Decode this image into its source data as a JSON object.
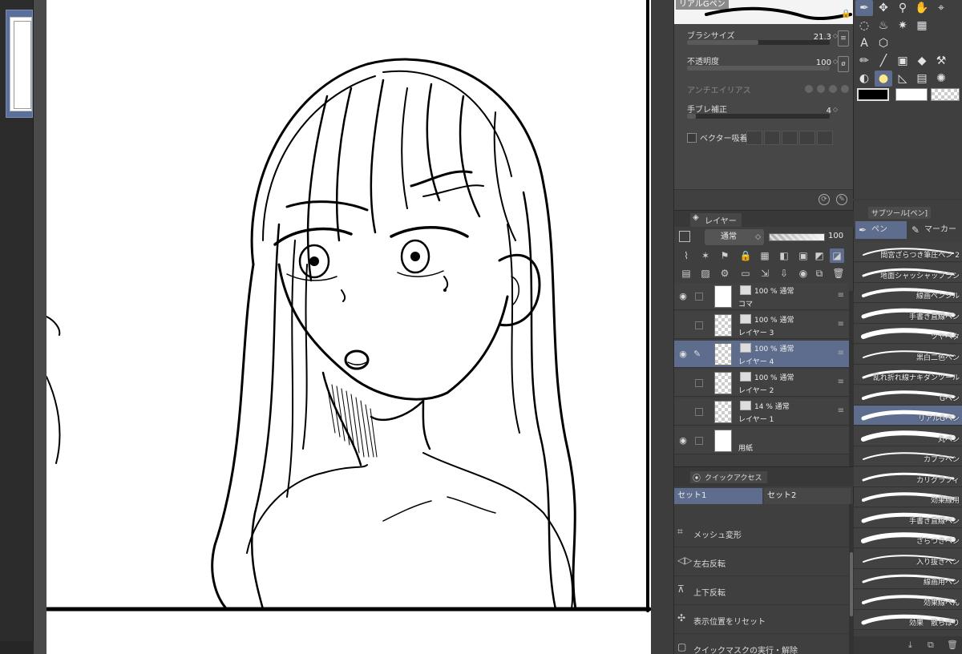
{
  "tool_property": {
    "brush_name": "リアルGペン",
    "brush_size_label": "ブラシサイズ",
    "brush_size_value": "21.3",
    "brush_size_fill": 0.5,
    "opacity_label": "不透明度",
    "opacity_value": "100",
    "opacity_fill": 1.0,
    "antialias_label": "アンチエイリアス",
    "stabilization_label": "手ブレ補正",
    "stabilization_value": "4",
    "stabilization_fill": 0.04,
    "vector_snap_label": "ベクター吸着"
  },
  "layer_panel": {
    "tab_label": "レイヤー",
    "blend_mode": "通常",
    "opacity": "100",
    "layers": [
      {
        "line1": "100 % 通常",
        "line2": "コマ",
        "visible": true,
        "selected": false
      },
      {
        "line1": "100 % 通常",
        "line2": "レイヤー 3",
        "visible": false,
        "selected": false
      },
      {
        "line1": "100 % 通常",
        "line2": "レイヤー 4",
        "visible": true,
        "selected": true
      },
      {
        "line1": "100 % 通常",
        "line2": "レイヤー 2",
        "visible": false,
        "selected": false
      },
      {
        "line1": "14 % 通常",
        "line2": "レイヤー 1",
        "visible": false,
        "selected": false
      },
      {
        "line1": "",
        "line2": "用紙",
        "visible": true,
        "selected": false
      }
    ]
  },
  "quick_access": {
    "tab_label": "クイックアクセス",
    "sets": [
      "セット1",
      "セット2"
    ],
    "items": [
      {
        "icon": "mesh-transform-icon",
        "label": "メッシュ変形"
      },
      {
        "icon": "flip-horizontal-icon",
        "label": "左右反転"
      },
      {
        "icon": "flip-vertical-icon",
        "label": "上下反転"
      },
      {
        "icon": "reset-view-icon",
        "label": "表示位置をリセット"
      },
      {
        "icon": "quick-mask-icon",
        "label": "クイックマスクの実行・解除"
      }
    ]
  },
  "subtool_panel": {
    "title": "サブツール[ペン]",
    "tabs": [
      "ペン",
      "マーカー"
    ],
    "brushes": [
      "間宮ざらつき筆圧ペン 2",
      "地面シャッシャッブラシ",
      "線画ペンシル",
      "手書き直線ペン",
      "ツヤベタ",
      "黒白二色ペン",
      "乱れ折れ線ナキダンツール",
      "Gペン",
      "リアルGペン",
      "丸ペン",
      "カブラペン",
      "カリグラフィ",
      "効果線用",
      "手書き直線ペン",
      "ざらつきペン",
      "入り抜きペン",
      "線画用ペン",
      "効果線ぺん",
      "効果　散らばり"
    ],
    "active_index": 8
  },
  "colors": {
    "main": "#000000",
    "sub": "#ffffff",
    "accent": "#5e6d8e"
  }
}
